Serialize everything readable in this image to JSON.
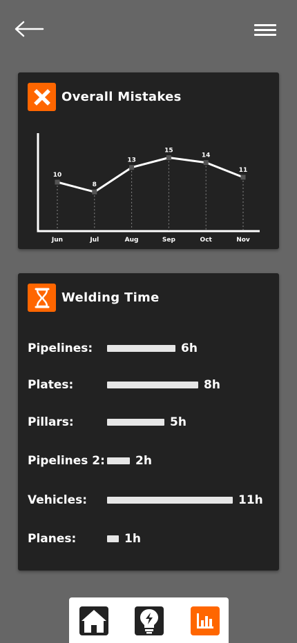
{
  "header": {
    "back_icon": "arrow-left-icon",
    "menu_icon": "hamburger-menu-icon"
  },
  "mistakes": {
    "title": "Overall Mistakes",
    "icon": "x-mark-icon",
    "chart_data": {
      "type": "line",
      "title": "",
      "categories": [
        "Jun",
        "Jul",
        "Aug",
        "Sep",
        "Oct",
        "Nov"
      ],
      "values": [
        10,
        8,
        13,
        15,
        14,
        11
      ],
      "ylim": [
        0,
        20
      ],
      "grid": false,
      "data_labels": true
    }
  },
  "welding": {
    "title": "Welding Time",
    "icon": "hourglass-icon",
    "rows": [
      {
        "label": "Pipelines:",
        "hours": 6,
        "value": "6h"
      },
      {
        "label": "Plates:",
        "hours": 8,
        "value": "8h"
      },
      {
        "label": "Pillars:",
        "hours": 5,
        "value": "5h"
      },
      {
        "label": "Pipelines 2:",
        "hours": 2,
        "value": "2h"
      },
      {
        "label": "Vehicles:",
        "hours": 11,
        "value": "11h"
      },
      {
        "label": "Planes:",
        "hours": 1,
        "value": "1h"
      }
    ]
  },
  "nav": {
    "items": [
      {
        "icon": "home-icon",
        "active": false
      },
      {
        "icon": "lightbulb-icon",
        "active": false
      },
      {
        "icon": "bar-chart-icon",
        "active": true
      }
    ]
  },
  "colors": {
    "background": "#666666",
    "card": "#222222",
    "accent": "#ff6600",
    "bar": "#e6e6e6"
  }
}
